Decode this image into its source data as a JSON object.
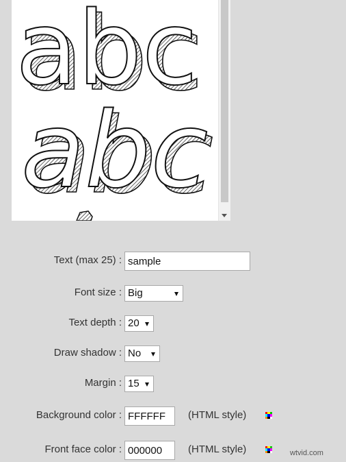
{
  "preview": {
    "line1_text": "abc",
    "line2_text": "abc"
  },
  "form": {
    "text_label": "Text (max 25) :",
    "text_value": "sample",
    "font_size_label": "Font size :",
    "font_size_value": "Big",
    "text_depth_label": "Text depth :",
    "text_depth_value": "20",
    "draw_shadow_label": "Draw shadow :",
    "draw_shadow_value": "No",
    "margin_label": "Margin :",
    "margin_value": "15",
    "bg_color_label": "Background color :",
    "bg_color_value": "FFFFFF",
    "bg_color_hint": "(HTML style)",
    "front_color_label": "Front face color :",
    "front_color_value": "000000",
    "front_color_hint": "(HTML style)"
  },
  "watermark": "wtvid.com",
  "colors": {
    "page_bg": "#dadada",
    "preview_bg": "#ffffff",
    "picker": [
      "#ff0000",
      "#ffff00",
      "#00cc00",
      "#00ffff",
      "#0000ff",
      "#ff00ff",
      "#ff8800",
      "#000000",
      "#ffffff"
    ]
  }
}
